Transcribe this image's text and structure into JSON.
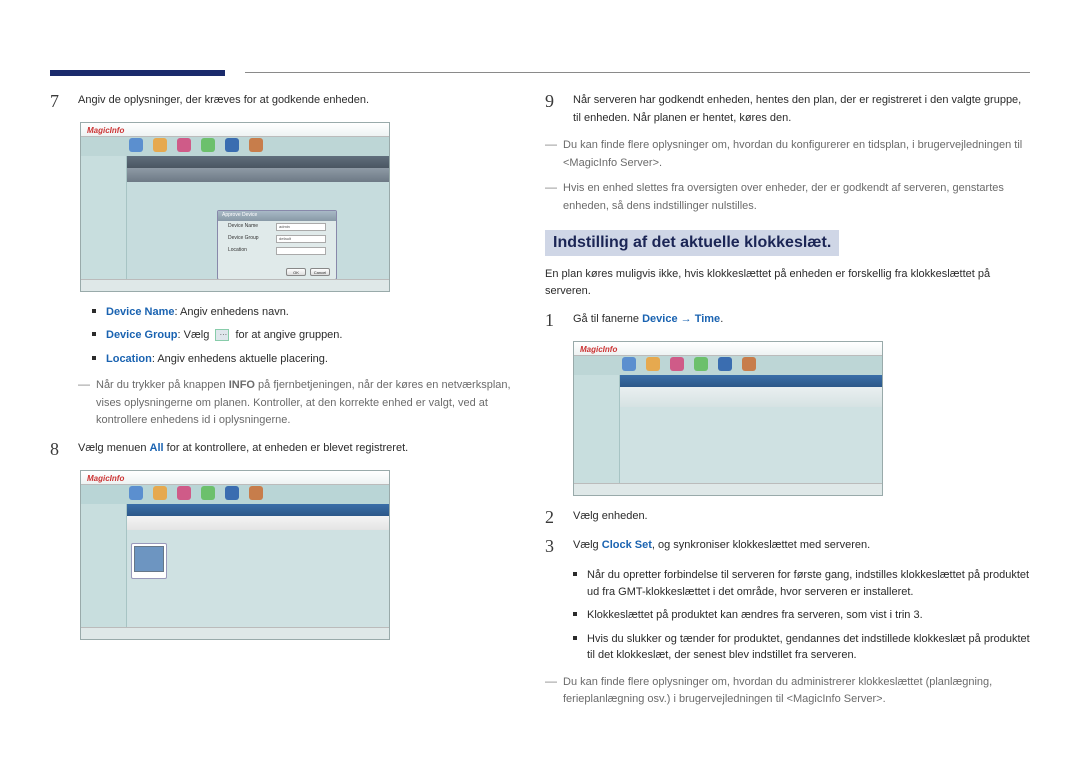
{
  "col_left": {
    "step7": {
      "num": "7",
      "text": "Angiv de oplysninger, der kræves for at godkende enheden."
    },
    "shot1": {
      "logo": "MagicInfo",
      "dialog": {
        "title": "Approve Device",
        "rows": [
          {
            "label": "Device Name",
            "value": "admin"
          },
          {
            "label": "Device Group",
            "value": "default"
          },
          {
            "label": "Location",
            "value": ""
          }
        ],
        "ok": "OK",
        "cancel": "Cancel"
      }
    },
    "b1_label": "Device Name",
    "b1_rest": ": Angiv enhedens navn.",
    "b2_label": "Device Group",
    "b2_mid": ": Vælg",
    "b2_rest": "for at angive gruppen.",
    "b3_label": "Location",
    "b3_rest": ": Angiv enhedens aktuelle placering.",
    "note1a": "Når du trykker på knappen ",
    "note1_info": "INFO",
    "note1b": " på fjernbetjeningen, når der køres en netværksplan, vises oplysningerne om planen. Kontroller, at den korrekte enhed er valgt, ved at kontrollere enhedens id i oplysningerne.",
    "step8": {
      "num": "8",
      "pre": "Vælg menuen ",
      "all": "All",
      "post": " for at kontrollere, at enheden er blevet registreret."
    },
    "shot2": {
      "logo": "MagicInfo"
    }
  },
  "col_right": {
    "step9": {
      "num": "9",
      "text": "Når serveren har godkendt enheden, hentes den plan, der er registreret i den valgte gruppe, til enheden. Når planen er hentet, køres den."
    },
    "note_r1": "Du kan finde flere oplysninger om, hvordan du konfigurerer en tidsplan, i brugervejledningen til <MagicInfo Server>.",
    "note_r2": "Hvis en enhed slettes fra oversigten over enheder, der er godkendt af serveren, genstartes enheden, så dens indstillinger nulstilles.",
    "heading": "Indstilling af det aktuelle klokkeslæt.",
    "intro": "En plan køres muligvis ikke, hvis klokkeslættet på enheden er forskellig fra klokkeslættet på serveren.",
    "step1": {
      "num": "1",
      "pre": "Gå til fanerne ",
      "device": "Device",
      "arrow": " → ",
      "time": "Time",
      "post": "."
    },
    "shot3": {
      "logo": "MagicInfo"
    },
    "step2": {
      "num": "2",
      "text": "Vælg enheden."
    },
    "step3": {
      "num": "3",
      "pre": "Vælg ",
      "clockset": "Clock Set",
      "post": ", og synkroniser klokkeslættet med serveren."
    },
    "bul1": "Når du opretter forbindelse til serveren for første gang, indstilles klokkeslættet på produktet ud fra GMT-klokkeslættet i det område, hvor serveren er installeret.",
    "bul2": "Klokkeslættet på produktet kan ændres fra serveren, som vist i trin 3.",
    "bul3": "Hvis du slukker og tænder for produktet, gendannes det indstillede klokkeslæt på produktet til det klokkeslæt, der senest blev indstillet fra serveren.",
    "note_last": "Du kan finde flere oplysninger om, hvordan du administrerer klokkeslættet (planlægning, ferieplanlægning osv.) i brugervejledningen til <MagicInfo Server>."
  }
}
